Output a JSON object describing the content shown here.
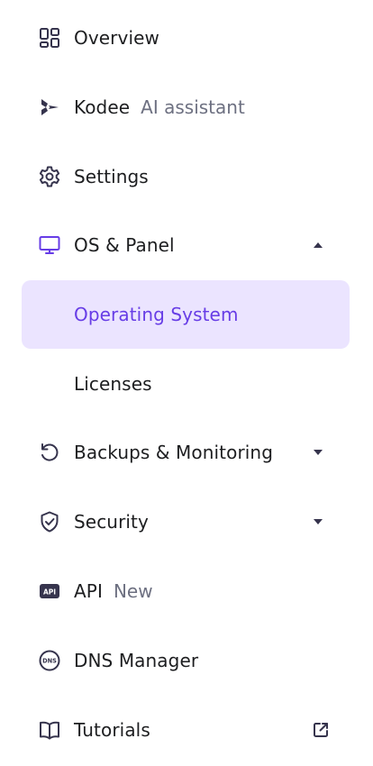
{
  "colors": {
    "accent": "#673de6",
    "active_bg": "#ebe4ff",
    "text": "#1d1e20",
    "muted": "#6d7081",
    "icon": "#36344d"
  },
  "menu": {
    "overview": {
      "label": "Overview",
      "icon": "grid-icon"
    },
    "kodee": {
      "label": "Kodee",
      "tag": "AI assistant",
      "icon": "kodee-icon"
    },
    "settings": {
      "label": "Settings",
      "icon": "gear-icon"
    },
    "os_panel": {
      "label": "OS & Panel",
      "icon": "monitor-icon",
      "expanded": true,
      "children": [
        {
          "label": "Operating System",
          "active": true
        },
        {
          "label": "Licenses",
          "active": false
        }
      ]
    },
    "backups": {
      "label": "Backups & Monitoring",
      "icon": "restore-icon",
      "expanded": false
    },
    "security": {
      "label": "Security",
      "icon": "shield-icon",
      "expanded": false
    },
    "api": {
      "label": "API",
      "tag": "New",
      "icon": "api-icon",
      "icon_text": "API"
    },
    "dns": {
      "label": "DNS Manager",
      "icon": "dns-icon",
      "icon_text": "DNS"
    },
    "tutorials": {
      "label": "Tutorials",
      "icon": "book-icon",
      "external": true
    }
  }
}
